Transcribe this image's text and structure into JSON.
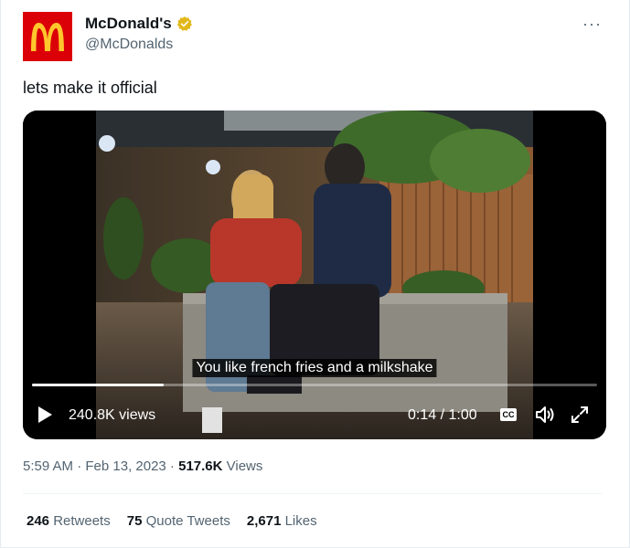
{
  "author": {
    "display_name": "McDonald's",
    "handle": "@McDonalds",
    "logo_color": "#db0007",
    "logo_arch_color": "#ffc72c",
    "verified_badge_color": "#e2b719"
  },
  "tweet": {
    "text": "lets make it official"
  },
  "video": {
    "caption": "You like french fries and a milkshake",
    "views": "240.8K views",
    "time": "0:14 / 1:00",
    "progress": 0.233,
    "cc_label": "CC"
  },
  "meta": {
    "timestamp": "5:59 AM · Feb 13, 2023 · ",
    "views_count": "517.6K",
    "views_label": " Views"
  },
  "stats": [
    {
      "count": "246",
      "label": " Retweets"
    },
    {
      "count": "75",
      "label": " Quote Tweets"
    },
    {
      "count": "2,671",
      "label": " Likes"
    }
  ]
}
